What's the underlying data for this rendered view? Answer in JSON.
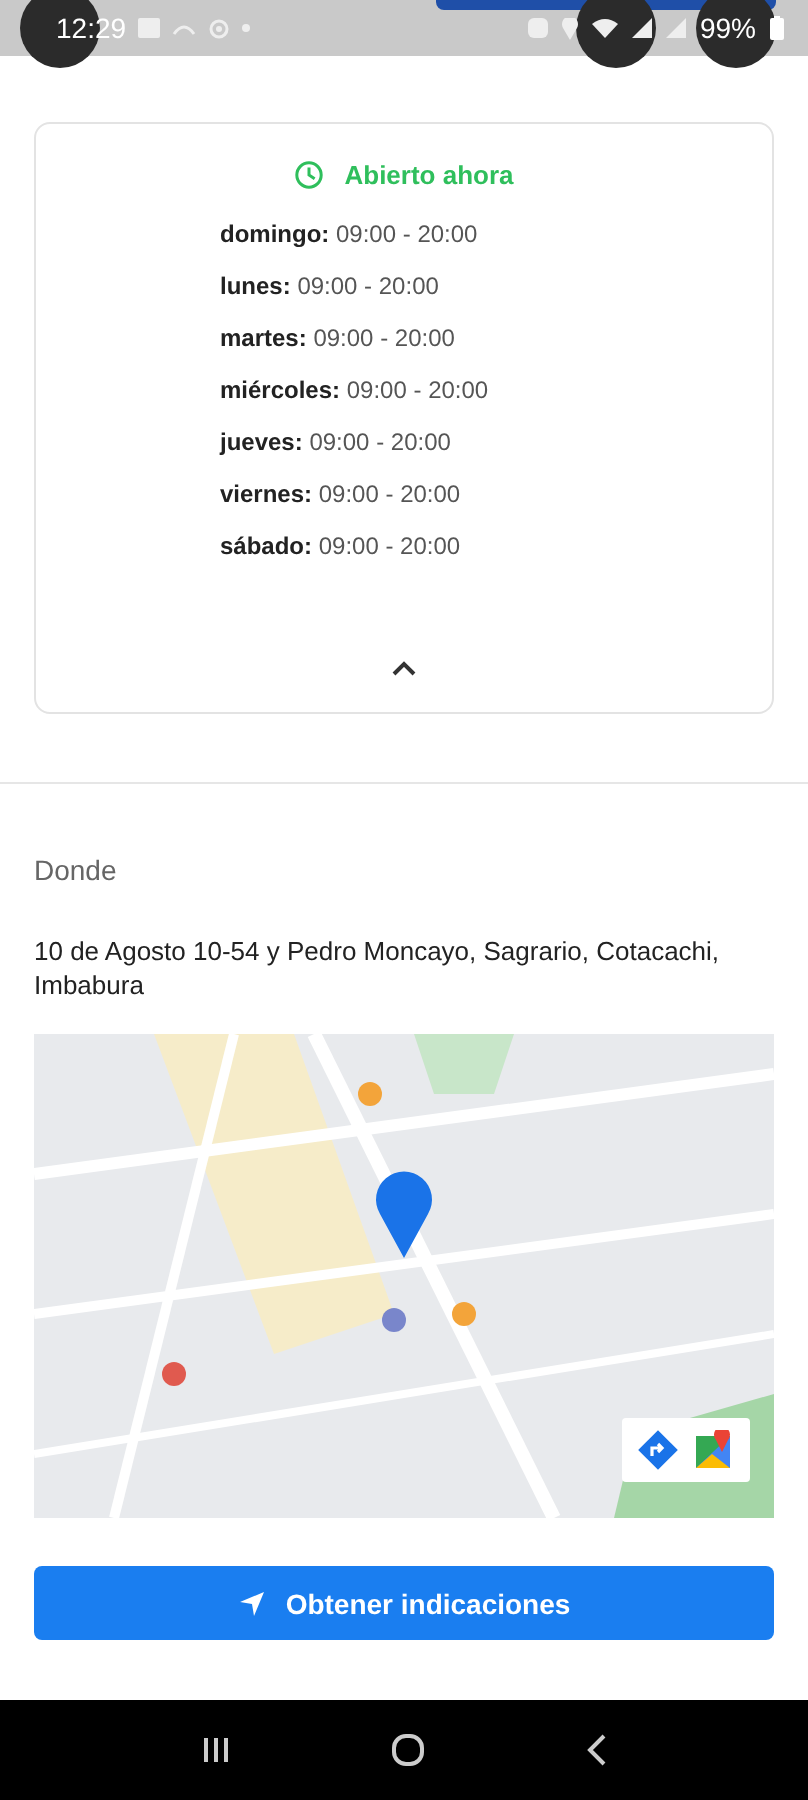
{
  "status_bar": {
    "time": "12:29",
    "battery": "99%"
  },
  "hours": {
    "status": "Abierto ahora",
    "days": [
      {
        "day": "domingo:",
        "hours": "09:00 - 20:00"
      },
      {
        "day": "lunes:",
        "hours": "09:00 - 20:00"
      },
      {
        "day": "martes:",
        "hours": "09:00 - 20:00"
      },
      {
        "day": "miércoles:",
        "hours": "09:00 - 20:00"
      },
      {
        "day": "jueves:",
        "hours": "09:00 - 20:00"
      },
      {
        "day": "viernes:",
        "hours": "09:00 - 20:00"
      },
      {
        "day": "sábado:",
        "hours": "09:00 - 20:00"
      }
    ],
    "expanded": true
  },
  "location": {
    "title": "Donde",
    "address": "10 de Agosto 10-54 y Pedro Moncayo, Sagrario, Cotacachi, Imbabura"
  },
  "directions_button": {
    "label": "Obtener indicaciones"
  }
}
